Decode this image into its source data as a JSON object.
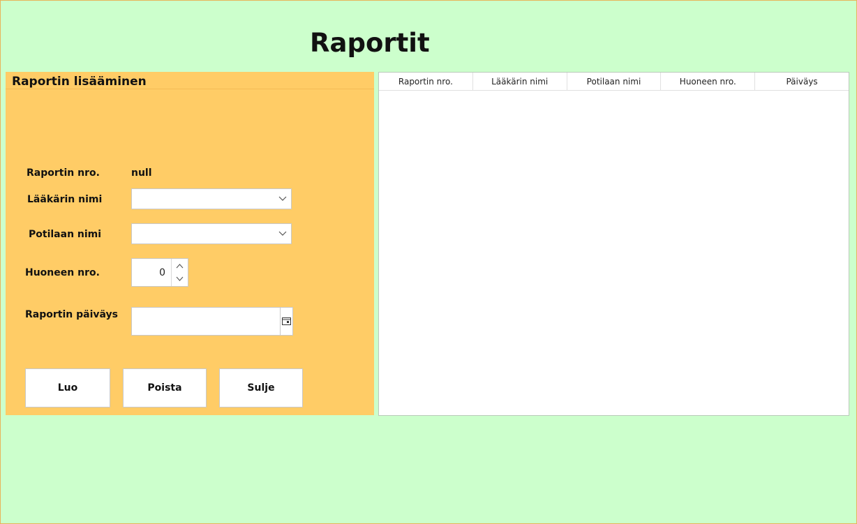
{
  "page": {
    "title": "Raportit"
  },
  "form": {
    "title": "Raportin lisääminen",
    "report_no_label": "Raportin nro.",
    "report_no_value": "null",
    "doctor_label": "Lääkärin nimi",
    "doctor_value": "",
    "patient_label": "Potilaan nimi",
    "patient_value": "",
    "room_label": "Huoneen nro.",
    "room_value": "0",
    "date_label": "Raportin päiväys",
    "date_value": ""
  },
  "buttons": {
    "create": "Luo",
    "delete": "Poista",
    "close": "Sulje"
  },
  "table": {
    "columns": [
      "Raportin nro.",
      "Lääkärin nimi",
      "Potilaan nimi",
      "Huoneen nro.",
      "Päiväys"
    ],
    "rows": []
  },
  "colors": {
    "background": "#ccffcc",
    "panel": "#ffcc66"
  },
  "icons": {
    "dropdown": "chevron-down-icon",
    "spin_up": "chevron-up-icon",
    "spin_down": "chevron-down-icon",
    "calendar": "calendar-icon"
  }
}
